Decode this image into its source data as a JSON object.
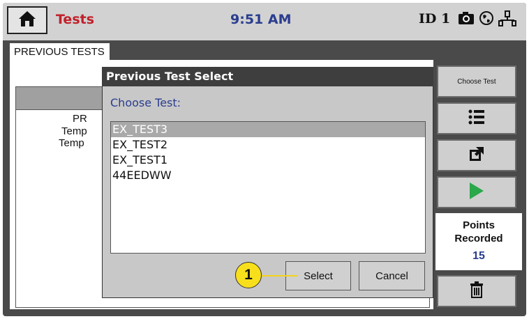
{
  "header": {
    "title": "Tests",
    "time": "9:51 AM",
    "device_id": "ID 1",
    "icons": [
      "home-icon",
      "camera-icon",
      "globe-icon",
      "network-icon"
    ],
    "title_color": "#c0212b",
    "time_color": "#2a3d8f"
  },
  "tab": {
    "label": "PREVIOUS TESTS"
  },
  "background_partial": {
    "line1": "PR",
    "line2": "Temp",
    "line3": "Temp"
  },
  "side": {
    "choose_test_label": "Choose Test",
    "list_icon": "list-icon",
    "export_icon": "export-icon",
    "play_icon": "play-icon",
    "points_label_1": "Points",
    "points_label_2": "Recorded",
    "points_value": "15",
    "trash_icon": "trash-icon"
  },
  "dialog": {
    "title": "Previous Test Select",
    "prompt": "Choose Test:",
    "items": [
      "EX_TEST3",
      "EX_TEST2",
      "EX_TEST1",
      "44EEDWW"
    ],
    "selected_index": 0,
    "select_label": "Select",
    "cancel_label": "Cancel"
  },
  "callout": {
    "number": "1",
    "color": "#f8df1c"
  }
}
